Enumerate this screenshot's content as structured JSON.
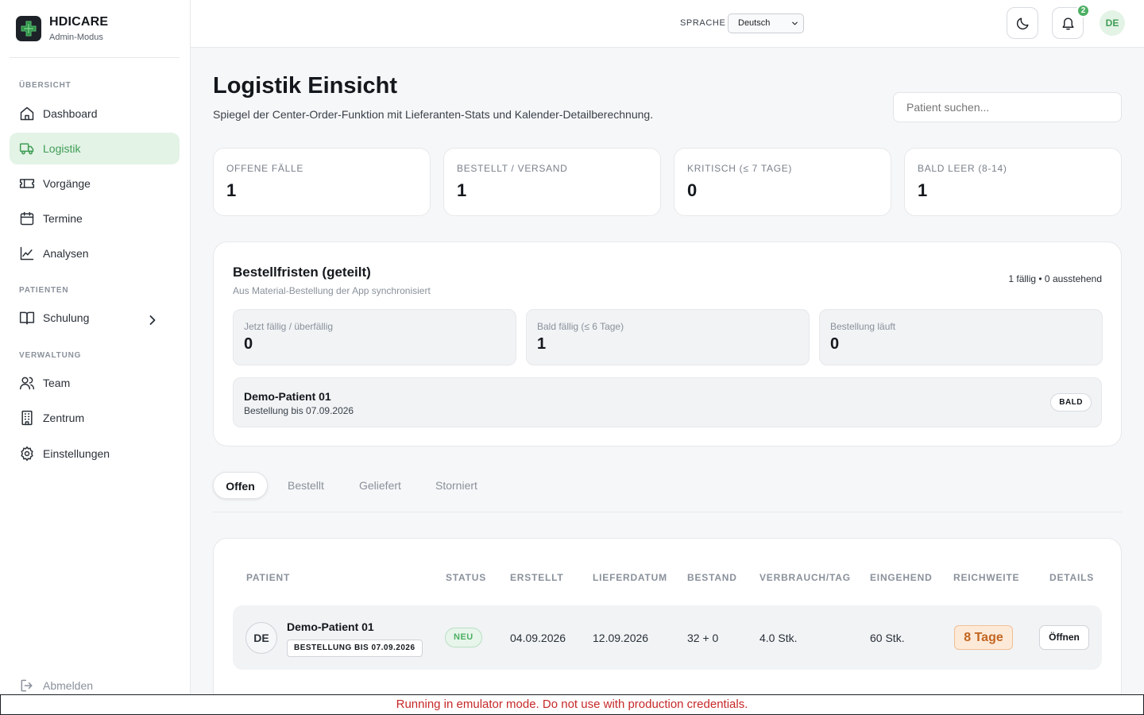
{
  "brand": {
    "name": "HDICARE",
    "mode": "Admin-Modus"
  },
  "sidebar": {
    "sections": [
      {
        "label": "ÜBERSICHT"
      },
      {
        "label": "PATIENTEN"
      },
      {
        "label": "VERWALTUNG"
      }
    ],
    "items": [
      {
        "label": "Dashboard",
        "icon": "home-icon"
      },
      {
        "label": "Logistik",
        "icon": "truck-icon",
        "active": true
      },
      {
        "label": "Vorgänge",
        "icon": "ticket-icon"
      },
      {
        "label": "Termine",
        "icon": "calendar-icon"
      },
      {
        "label": "Analysen",
        "icon": "chart-line-icon"
      },
      {
        "label": "Schulung",
        "icon": "book-icon"
      },
      {
        "label": "Team",
        "icon": "users-icon"
      },
      {
        "label": "Zentrum",
        "icon": "building-icon"
      },
      {
        "label": "Einstellungen",
        "icon": "gear-icon"
      }
    ],
    "logout": "Abmelden"
  },
  "topbar": {
    "language_label": "SPRACHE",
    "language_value": "Deutsch",
    "notification_count": "2",
    "avatar_initials": "DE"
  },
  "page": {
    "title": "Logistik Einsicht",
    "subtitle": "Spiegel der Center-Order-Funktion mit Lieferanten-Stats und Kalender-Detailberechnung.",
    "search_placeholder": "Patient suchen..."
  },
  "stats": [
    {
      "label": "OFFENE FÄLLE",
      "value": "1"
    },
    {
      "label": "BESTELLT / VERSAND",
      "value": "1"
    },
    {
      "label": "KRITISCH (≤ 7 TAGE)",
      "value": "0"
    },
    {
      "label": "BALD LEER (8-14)",
      "value": "1"
    }
  ],
  "deadlines": {
    "title": "Bestellfristen (geteilt)",
    "subtitle": "Aus Material-Bestellung der App synchronisiert",
    "meta": "1 fällig • 0 ausstehend",
    "cards": [
      {
        "label": "Jetzt fällig / überfällig",
        "value": "0"
      },
      {
        "label": "Bald fällig (≤ 6 Tage)",
        "value": "1"
      },
      {
        "label": "Bestellung läuft",
        "value": "0"
      }
    ],
    "patient": {
      "name": "Demo-Patient 01",
      "sub": "Bestellung bis 07.09.2026",
      "badge": "BALD"
    }
  },
  "tabs": [
    "Offen",
    "Bestellt",
    "Geliefert",
    "Storniert"
  ],
  "table": {
    "headers": [
      "PATIENT",
      "STATUS",
      "ERSTELLT",
      "LIEFERDATUM",
      "BESTAND",
      "VERBRAUCH/TAG",
      "EINGEHEND",
      "REICHWEITE",
      "DETAILS"
    ],
    "rows": [
      {
        "initials": "DE",
        "name": "Demo-Patient 01",
        "tag": "BESTELLUNG BIS 07.09.2026",
        "status": "NEU",
        "created": "04.09.2026",
        "delivery": "12.09.2026",
        "stock": "32 + 0",
        "usage": "4.0 Stk.",
        "incoming": "60 Stk.",
        "reach": "8 Tage",
        "action": "Öffnen"
      }
    ]
  },
  "emulator_notice": "Running in emulator mode. Do not use with production credentials.",
  "colors": {
    "accent": "#4caf63",
    "active_bg": "#e3f3e6",
    "warning": "#c2651f",
    "danger_text": "#c62828"
  }
}
